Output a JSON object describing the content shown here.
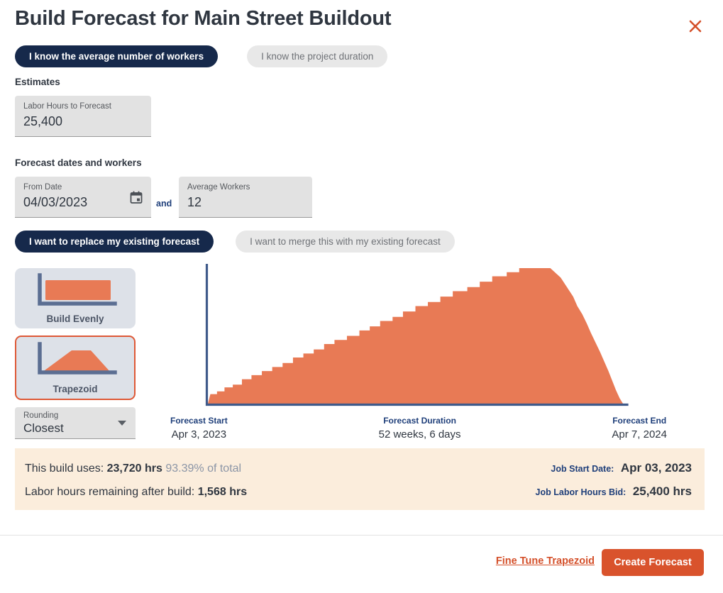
{
  "header": {
    "title": "Build Forecast for Main Street Buildout",
    "close_icon": "close-icon"
  },
  "mode_tabs": [
    {
      "label": "I know the average number of workers",
      "selected": true
    },
    {
      "label": "I know the project duration",
      "selected": false
    }
  ],
  "sections": {
    "estimates_label": "Estimates",
    "forecast_label": "Forecast dates and workers"
  },
  "fields": {
    "labor_hours": {
      "label": "Labor Hours to Forecast",
      "value": "25,400"
    },
    "from_date": {
      "label": "From Date",
      "value": "04/03/2023",
      "icon": "calendar-icon"
    },
    "conjunction": "and",
    "average_workers": {
      "label": "Average Workers",
      "value": "12"
    }
  },
  "merge_tabs": [
    {
      "label": "I want to replace my existing forecast",
      "selected": true
    },
    {
      "label": "I want to merge this with my existing forecast",
      "selected": false
    }
  ],
  "shape_cards": [
    {
      "label": "Build Evenly",
      "icon": "even-build-chart-icon",
      "selected": false
    },
    {
      "label": "Trapezoid",
      "icon": "trapezoid-chart-icon",
      "selected": true
    }
  ],
  "rounding": {
    "label": "Rounding",
    "value": "Closest",
    "icon": "chevron-down-icon"
  },
  "chart_stats": [
    {
      "label": "Forecast Start",
      "value": "Apr 3, 2023"
    },
    {
      "label": "Forecast Duration",
      "value": "52 weeks, 6 days"
    },
    {
      "label": "Forecast End",
      "value": "Apr 7, 2024"
    }
  ],
  "summary": {
    "uses_label": "This build uses:",
    "uses_value": "23,720 hrs",
    "uses_percent": "93.39% of total",
    "remaining_label": "Labor hours remaining after build:",
    "remaining_value": "1,568 hrs",
    "job_start_label": "Job Start Date:",
    "job_start_value": "Apr 03, 2023",
    "job_bid_label": "Job Labor Hours Bid:",
    "job_bid_value": "25,400 hrs"
  },
  "footer": {
    "fine_tune_link": "Fine Tune Trapezoid",
    "create_button": "Create Forecast"
  },
  "colors": {
    "accent_orange": "#e87a55",
    "button_orange": "#d9532c",
    "navy": "#16294b",
    "axis_blue": "#3f5a8a",
    "banner_bg": "#fbeddc",
    "label_blue": "#1f3f7a"
  },
  "chart_data": {
    "type": "area",
    "title": "",
    "xlabel": "",
    "ylabel": "",
    "grid": false,
    "legend": null,
    "x_start": "Apr 3, 2023",
    "x_end": "Apr 7, 2024",
    "duration": "52 weeks, 6 days",
    "total_hours": 23720,
    "percent_of_total": 93.39,
    "shape": "trapezoid",
    "axis_range_x": [
      0,
      100
    ],
    "axis_range_y": [
      0,
      100
    ],
    "points": [
      [
        0,
        0
      ],
      [
        0.6,
        7
      ],
      [
        2.2,
        7
      ],
      [
        2.2,
        9
      ],
      [
        4.0,
        9
      ],
      [
        4.0,
        12
      ],
      [
        6.0,
        12
      ],
      [
        6.0,
        14
      ],
      [
        8.2,
        14
      ],
      [
        8.2,
        18
      ],
      [
        10.5,
        18
      ],
      [
        10.5,
        21
      ],
      [
        13.0,
        21
      ],
      [
        13.0,
        24
      ],
      [
        15.5,
        24
      ],
      [
        15.5,
        27
      ],
      [
        18.0,
        27
      ],
      [
        18.0,
        30
      ],
      [
        20.5,
        30
      ],
      [
        20.5,
        34
      ],
      [
        23.0,
        34
      ],
      [
        23.0,
        37
      ],
      [
        25.5,
        37
      ],
      [
        25.5,
        40
      ],
      [
        28.0,
        40
      ],
      [
        28.0,
        44
      ],
      [
        30.5,
        44
      ],
      [
        30.5,
        47
      ],
      [
        33.5,
        47
      ],
      [
        33.5,
        50
      ],
      [
        36.5,
        50
      ],
      [
        36.5,
        54
      ],
      [
        39.0,
        54
      ],
      [
        39.0,
        57
      ],
      [
        41.5,
        57
      ],
      [
        41.5,
        61
      ],
      [
        44.5,
        61
      ],
      [
        44.5,
        64
      ],
      [
        47.0,
        64
      ],
      [
        47.0,
        68
      ],
      [
        50.0,
        68
      ],
      [
        50.0,
        72
      ],
      [
        53.0,
        72
      ],
      [
        53.0,
        75
      ],
      [
        56.0,
        75
      ],
      [
        56.0,
        79
      ],
      [
        59.0,
        79
      ],
      [
        59.0,
        83
      ],
      [
        62.5,
        83
      ],
      [
        62.5,
        86
      ],
      [
        65.5,
        86
      ],
      [
        65.5,
        90
      ],
      [
        68.5,
        90
      ],
      [
        68.5,
        94
      ],
      [
        72.0,
        94
      ],
      [
        72.0,
        97
      ],
      [
        75.0,
        97
      ],
      [
        75.0,
        100
      ],
      [
        78.0,
        100
      ],
      [
        82.5,
        100
      ],
      [
        85.0,
        93
      ],
      [
        86.5,
        86
      ],
      [
        88.0,
        79
      ],
      [
        89.0,
        72
      ],
      [
        90.2,
        66
      ],
      [
        91.3,
        59
      ],
      [
        92.3,
        52
      ],
      [
        93.4,
        45
      ],
      [
        94.5,
        38
      ],
      [
        95.5,
        31
      ],
      [
        96.5,
        24
      ],
      [
        97.4,
        17
      ],
      [
        98.3,
        10
      ],
      [
        99.2,
        4
      ],
      [
        100,
        0
      ]
    ]
  }
}
